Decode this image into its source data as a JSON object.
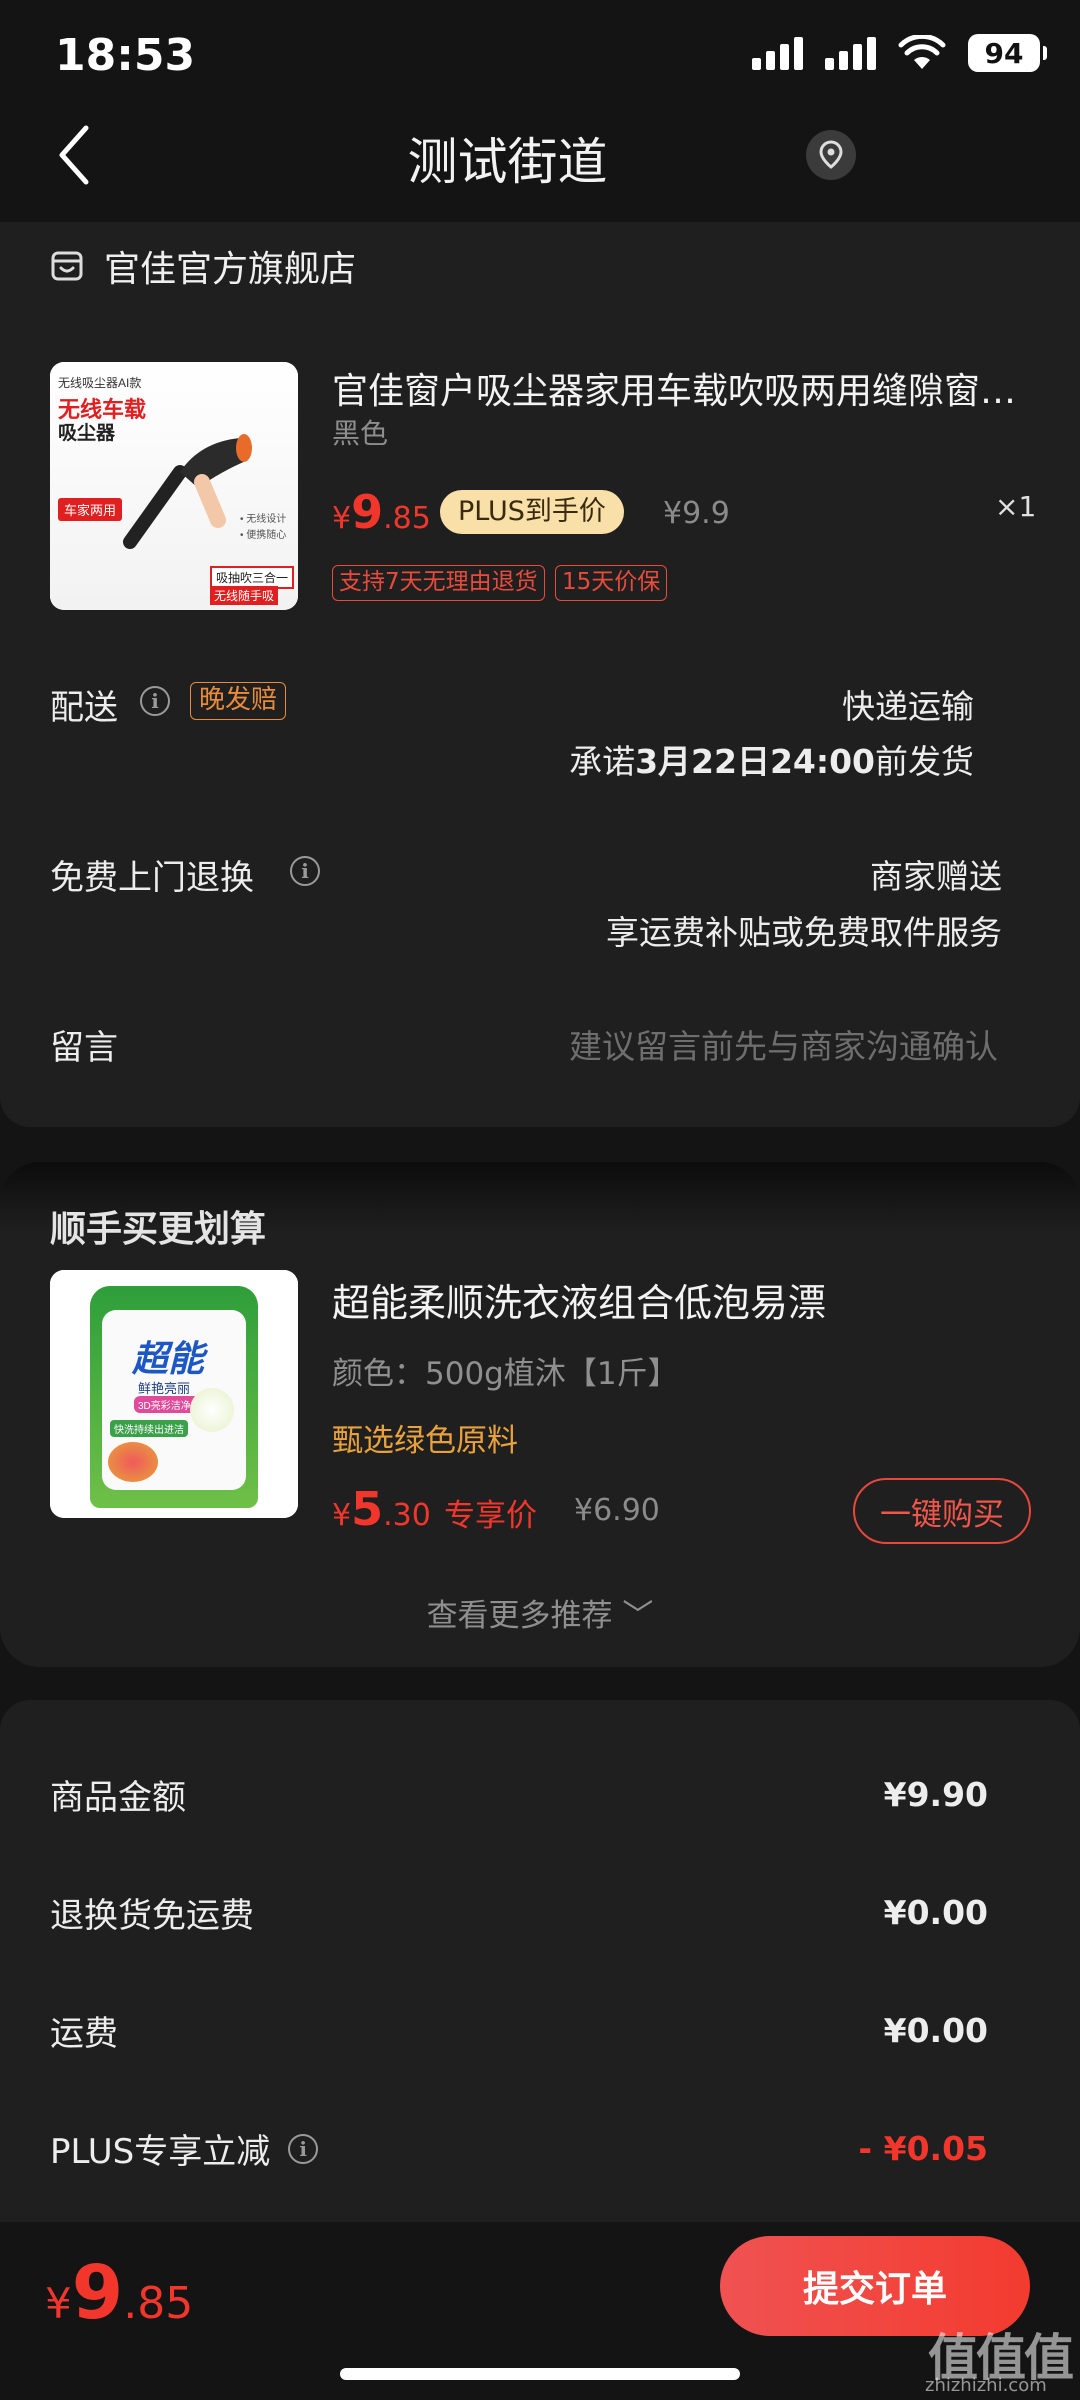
{
  "status_bar": {
    "time": "18:53",
    "battery": "94"
  },
  "nav": {
    "title": "测试街道"
  },
  "store": {
    "name": "官佳官方旗舰店"
  },
  "product": {
    "title": "官佳窗户吸尘器家用车载吹吸两用缝隙窗…",
    "variant": "黑色",
    "price_currency": "¥",
    "price_int": "9",
    "price_dec": ".85",
    "plus_label": "PLUS到手价",
    "orig_price": "¥9.9",
    "quantity": "×1",
    "tags": [
      "支持7天无理由退货",
      "15天价保"
    ],
    "thumb": {
      "line1": "无线吸尘器AI款",
      "line2": "无线车载",
      "line3": "吸尘器",
      "badge": "车家两用",
      "feat1": "• 无线设计",
      "feat2": "• 便携随心",
      "bottom1": "吸抽吹三合一",
      "bottom2": "无线随手吸"
    }
  },
  "delivery": {
    "label": "配送",
    "tag": "晚发赔",
    "method": "快递运输",
    "promise_pre": "承诺",
    "promise_date": "3月22日24:00",
    "promise_post": "前发货"
  },
  "return_service": {
    "label": "免费上门退换",
    "value": "商家赠送",
    "desc": "享运费补贴或免费取件服务"
  },
  "message": {
    "label": "留言",
    "placeholder": "建议留言前先与商家沟通确认"
  },
  "recommend": {
    "section_title": "顺手买更划算",
    "title": "超能柔顺洗衣液组合低泡易漂",
    "variant": "颜色：500g植沐【1斤】",
    "feature": "甄选绿色原料",
    "price_currency": "¥",
    "price_int": "5",
    "price_dec": ".30",
    "price_label": "专享价",
    "orig_price": "¥6.90",
    "buy_button": "一键购买",
    "more": "查看更多推荐 ﹀",
    "thumb": {
      "brand": "超能",
      "sub": "鲜艳亮丽",
      "tag": "3D亮彩洁净技术",
      "bottom": "快洗持续出进洁"
    }
  },
  "summary": {
    "rows": [
      {
        "label": "商品金额",
        "value": "¥9.90"
      },
      {
        "label": "退换货免运费",
        "value": "¥0.00"
      },
      {
        "label": "运费",
        "value": "¥0.00"
      },
      {
        "label": "PLUS专享立减",
        "value": "- ¥0.05"
      }
    ]
  },
  "bottom_bar": {
    "total_currency": "¥",
    "total_int": "9",
    "total_dec": ".85",
    "submit": "提交订单"
  },
  "watermark": {
    "main": "值值值",
    "sub": "zhizhizhi.com"
  },
  "colors": {
    "accent_red": "#f2362b",
    "plus_gold": "#f8e0a8",
    "feature_orange": "#e9a23b",
    "background": "#141414",
    "card": "#1f1f1f"
  }
}
